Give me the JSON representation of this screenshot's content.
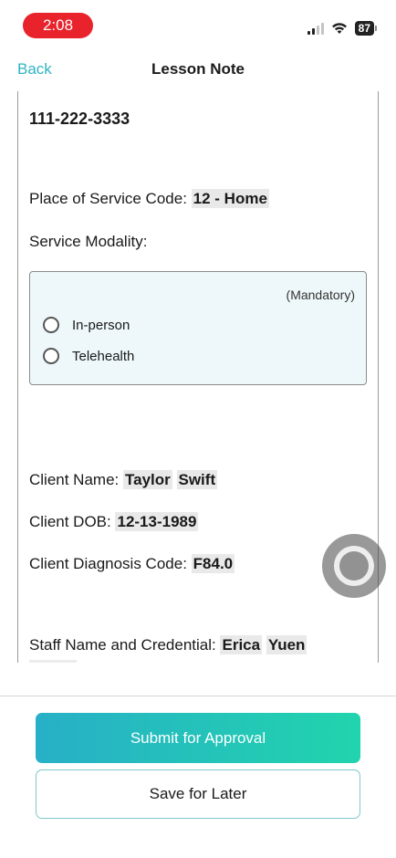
{
  "status_bar": {
    "time": "2:08",
    "battery": "87",
    "accent_color": "#e8232b"
  },
  "nav": {
    "back_label": "Back",
    "title": "Lesson Note"
  },
  "form": {
    "phone": "111-222-3333",
    "place_of_service_label": "Place of Service Code:",
    "place_of_service_value": "12 - Home",
    "service_modality_label": "Service Modality:",
    "mandatory_label": "(Mandatory)",
    "modality_options": [
      "In-person",
      "Telehealth"
    ],
    "client_name_label": "Client Name:",
    "client_name_first": "Taylor",
    "client_name_last": "Swift",
    "client_dob_label": "Client DOB:",
    "client_dob_value": "12-13-1989",
    "client_dx_label": "Client Diagnosis Code:",
    "client_dx_value": "F84.0",
    "staff_label": "Staff Name and Credential:",
    "staff_first": "Erica",
    "staff_last": "Yuen"
  },
  "actions": {
    "submit_label": "Submit for Approval",
    "save_label": "Save for Later",
    "gradient_start": "#27b0c7",
    "gradient_end": "#21d4ad"
  }
}
